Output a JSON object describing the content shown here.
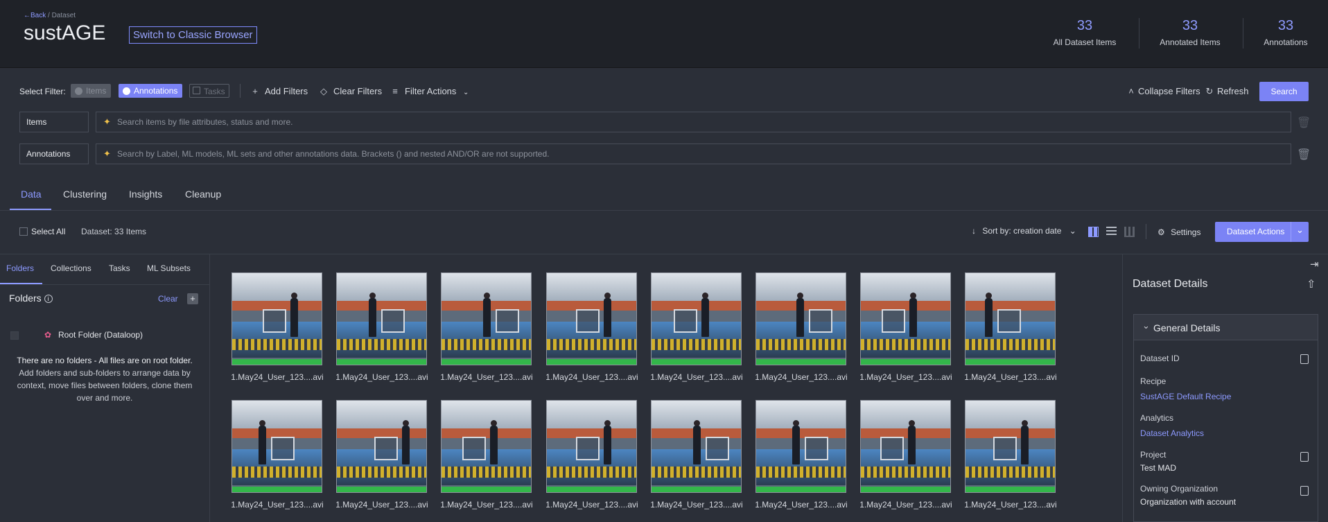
{
  "header": {
    "back_label": "Back",
    "breadcrumb_sep": "/",
    "breadcrumb_item": "Dataset",
    "title": "sustAGE",
    "classic_button": "Switch to Classic Browser",
    "stats": [
      {
        "value": "33",
        "label": "All Dataset Items"
      },
      {
        "value": "33",
        "label": "Annotated Items"
      },
      {
        "value": "33",
        "label": "Annotations"
      }
    ]
  },
  "filters": {
    "select_label": "Select Filter:",
    "chips": [
      "Items",
      "Annotations",
      "Tasks"
    ],
    "add_filters": "Add Filters",
    "clear_filters": "Clear Filters",
    "filter_actions": "Filter Actions",
    "collapse_filters": "Collapse Filters",
    "refresh": "Refresh",
    "search": "Search",
    "rows": [
      {
        "label": "Items",
        "placeholder": "Search items by file attributes, status and more."
      },
      {
        "label": "Annotations",
        "placeholder": "Search by Label, ML models, ML sets and other annotations data. Brackets () and nested AND/OR are not supported."
      }
    ]
  },
  "tabs": [
    "Data",
    "Clustering",
    "Insights",
    "Cleanup"
  ],
  "toolbar": {
    "select_all": "Select All",
    "dataset_count": "Dataset: 33 Items",
    "sort": "Sort by: creation date",
    "settings": "Settings",
    "dataset_actions": "Dataset Actions"
  },
  "left_panel": {
    "tabs": [
      "Folders",
      "Collections",
      "Tasks",
      "ML Subsets"
    ],
    "folders_title": "Folders",
    "clear": "Clear",
    "root_folder": "Root Folder (Dataloop)",
    "empty_title": "There are no folders - All files are on root folder.",
    "empty_body": "Add folders and sub-folders to arrange data by context, move files between folders, clone them over and more."
  },
  "items": [
    "1.May24_User_123....avi",
    "1.May24_User_123....avi",
    "1.May24_User_123....avi",
    "1.May24_User_123....avi",
    "1.May24_User_123....avi",
    "1.May24_User_123....avi",
    "1.May24_User_123....avi",
    "1.May24_User_123....avi",
    "1.May24_User_123....avi",
    "1.May24_User_123....avi",
    "1.May24_User_123....avi",
    "1.May24_User_123....avi",
    "1.May24_User_123....avi",
    "1.May24_User_123....avi",
    "1.May24_User_123....avi",
    "1.May24_User_123....avi"
  ],
  "details": {
    "title": "Dataset Details",
    "section": "General Details",
    "dataset_id_label": "Dataset ID",
    "recipe_label": "Recipe",
    "recipe_value": "SustAGE Default Recipe",
    "analytics_label": "Analytics",
    "analytics_value": "Dataset Analytics",
    "project_label": "Project",
    "project_value": "Test MAD",
    "org_label": "Owning Organization",
    "org_value": "Organization with account"
  },
  "colors": {
    "accent": "#7b83f5",
    "bg": "#2b2f38",
    "header_bg": "#1f2228"
  }
}
